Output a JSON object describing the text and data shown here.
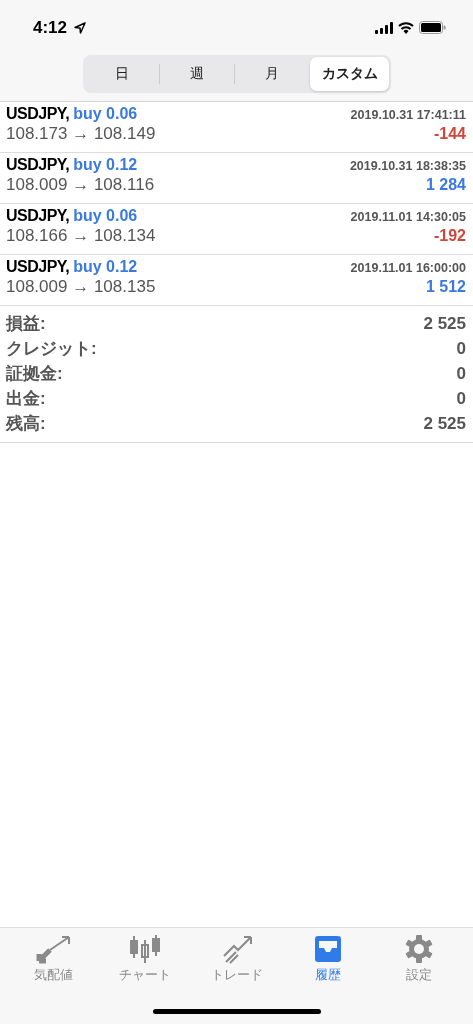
{
  "status_bar": {
    "time": "4:12"
  },
  "period_tabs": [
    {
      "label": "日",
      "selected": false
    },
    {
      "label": "週",
      "selected": false
    },
    {
      "label": "月",
      "selected": false
    },
    {
      "label": "カスタム",
      "selected": true
    }
  ],
  "deals": [
    {
      "symbol": "USDJPY,",
      "side": "buy 0.06",
      "time": "2019.10.31 17:41:11",
      "prices": "108.173 → 108.149",
      "profit": "-144",
      "color": "#d0463b"
    },
    {
      "symbol": "USDJPY,",
      "side": "buy 0.12",
      "time": "2019.10.31 18:38:35",
      "prices": "108.009 → 108.116",
      "profit": "1 284",
      "color": "#3a7ae0"
    },
    {
      "symbol": "USDJPY,",
      "side": "buy 0.06",
      "time": "2019.11.01 14:30:05",
      "prices": "108.166 → 108.134",
      "profit": "-192",
      "color": "#d0463b"
    },
    {
      "symbol": "USDJPY,",
      "side": "buy 0.12",
      "time": "2019.11.01 16:00:00",
      "prices": "108.009 → 108.135",
      "profit": "1 512",
      "color": "#3a7ae0"
    }
  ],
  "summary": [
    {
      "label": "損益:",
      "value": "2 525"
    },
    {
      "label": "クレジット:",
      "value": "0"
    },
    {
      "label": "証拠金:",
      "value": "0"
    },
    {
      "label": "出金:",
      "value": "0"
    },
    {
      "label": "残高:",
      "value": "2 525"
    }
  ],
  "tab_bar": [
    {
      "label": "気配値",
      "selected": false
    },
    {
      "label": "チャート",
      "selected": false
    },
    {
      "label": "トレード",
      "selected": false
    },
    {
      "label": "履歴",
      "selected": true
    },
    {
      "label": "設定",
      "selected": false
    }
  ]
}
